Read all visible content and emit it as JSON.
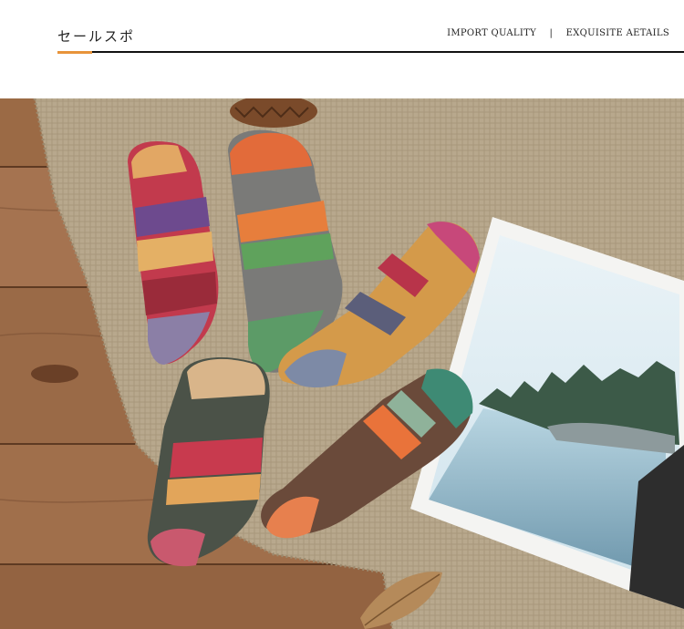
{
  "header": {
    "title": "セールスポ",
    "tag_quality": "IMPORT QUALITY",
    "tag_separator": "|",
    "tag_details": "EXQUISITE AETAILS"
  },
  "colors": {
    "accent": "#e8943a",
    "rule": "#111111",
    "wood": "#9a6b47",
    "burlap": "#b7a68b"
  },
  "photo": {
    "subject": "patterned-socks",
    "sock_count": 5
  }
}
